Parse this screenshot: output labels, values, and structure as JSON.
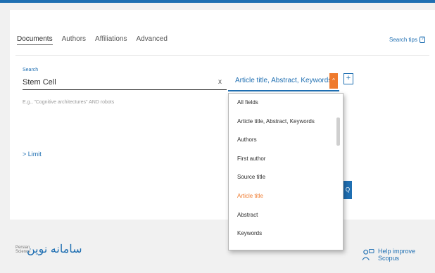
{
  "tabs": [
    {
      "label": "Documents",
      "active": true
    },
    {
      "label": "Authors"
    },
    {
      "label": "Affiliations"
    },
    {
      "label": "Advanced"
    }
  ],
  "search_tips": {
    "label": "Search tips",
    "icon": "question-icon"
  },
  "search": {
    "label": "Search",
    "value": "Stem Cell",
    "example": "E.g., \"Cognitive architectures\" AND robots",
    "clear": "x"
  },
  "field_select": {
    "value": "Article title, Abstract, Keywords",
    "chevron": "^"
  },
  "add_button": "+",
  "limit_link": "> Limit",
  "search_button": "Q",
  "dropdown": {
    "items": [
      "All fields",
      "Article title, Abstract, Keywords",
      "Authors",
      "First author",
      "Source title",
      "Article title",
      "Abstract",
      "Keywords"
    ],
    "selected_index": 5
  },
  "footer": {
    "logo_text": "سامانه نوین",
    "logo_small": "Persian Science",
    "help_label": "Help improve Scopus"
  },
  "colors": {
    "accent": "#1f6fb2",
    "highlight": "#ef7a2d"
  }
}
